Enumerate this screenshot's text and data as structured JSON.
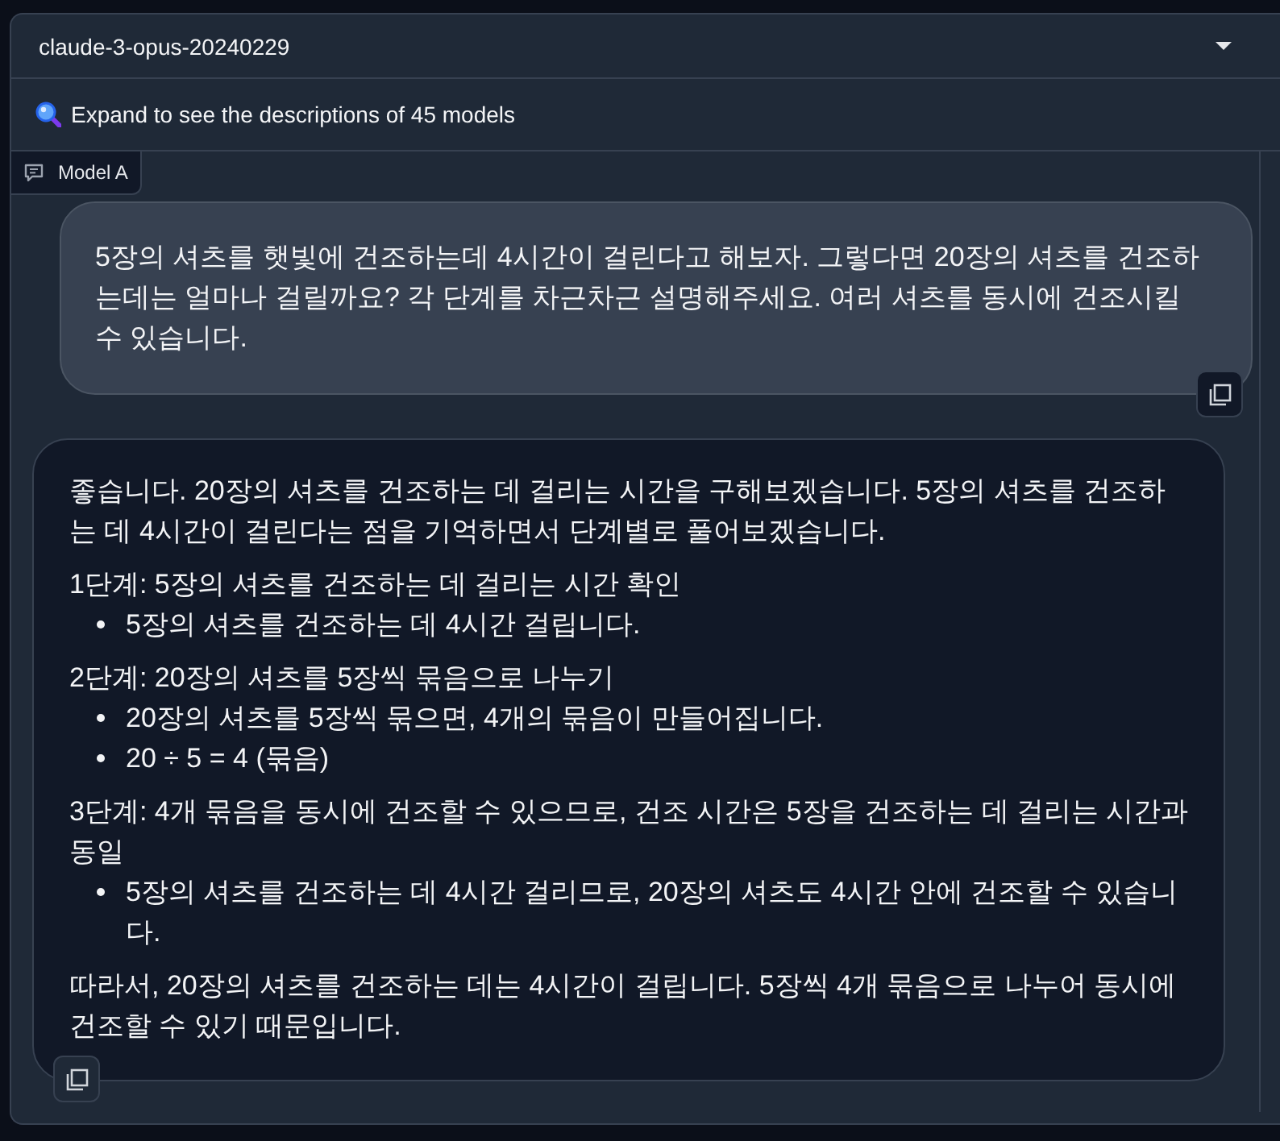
{
  "model_dropdown": {
    "value": "claude-3-opus-20240229"
  },
  "descriptions_accordion": {
    "label": "Expand to see the descriptions of 45 models"
  },
  "chat": {
    "label": "Model A",
    "messages": [
      {
        "kind": "user",
        "blocks": [
          {
            "kind": "paragraph",
            "text": "5장의 셔츠를 햇빛에 건조하는데 4시간이 걸린다고 해보자. 그렇다면 20장의 셔츠를 건조하는데는 얼마나 걸릴까요? 각 단계를 차근차근 설명해주세요. 여러 셔츠를 동시에 건조시킬 수 있습니다."
          }
        ]
      },
      {
        "kind": "assistant",
        "blocks": [
          {
            "kind": "paragraph",
            "text": "좋습니다. 20장의 셔츠를 건조하는 데 걸리는 시간을 구해보겠습니다. 5장의 셔츠를 건조하는 데 4시간이 걸린다는 점을 기억하면서 단계별로 풀어보겠습니다."
          },
          {
            "kind": "step",
            "text": "1단계: 5장의 셔츠를 건조하는 데 걸리는 시간 확인",
            "items": [
              "5장의 셔츠를 건조하는 데 4시간 걸립니다."
            ]
          },
          {
            "kind": "step",
            "text": "2단계: 20장의 셔츠를 5장씩 묶음으로 나누기",
            "items": [
              "20장의 셔츠를 5장씩 묶으면, 4개의 묶음이 만들어집니다.",
              "20 ÷ 5 = 4 (묶음)"
            ]
          },
          {
            "kind": "step",
            "text": "3단계: 4개 묶음을 동시에 건조할 수 있으므로, 건조 시간은 5장을 건조하는 데 걸리는 시간과 동일",
            "items": [
              "5장의 셔츠를 건조하는 데 4시간 걸리므로, 20장의 셔츠도 4시간 안에 건조할 수 있습니다."
            ]
          },
          {
            "kind": "paragraph",
            "text": "따라서, 20장의 셔츠를 건조하는 데는 4시간이 걸립니다. 5장씩 4개 묶음으로 나누어 동시에 건조할 수 있기 때문입니다."
          }
        ]
      }
    ]
  }
}
